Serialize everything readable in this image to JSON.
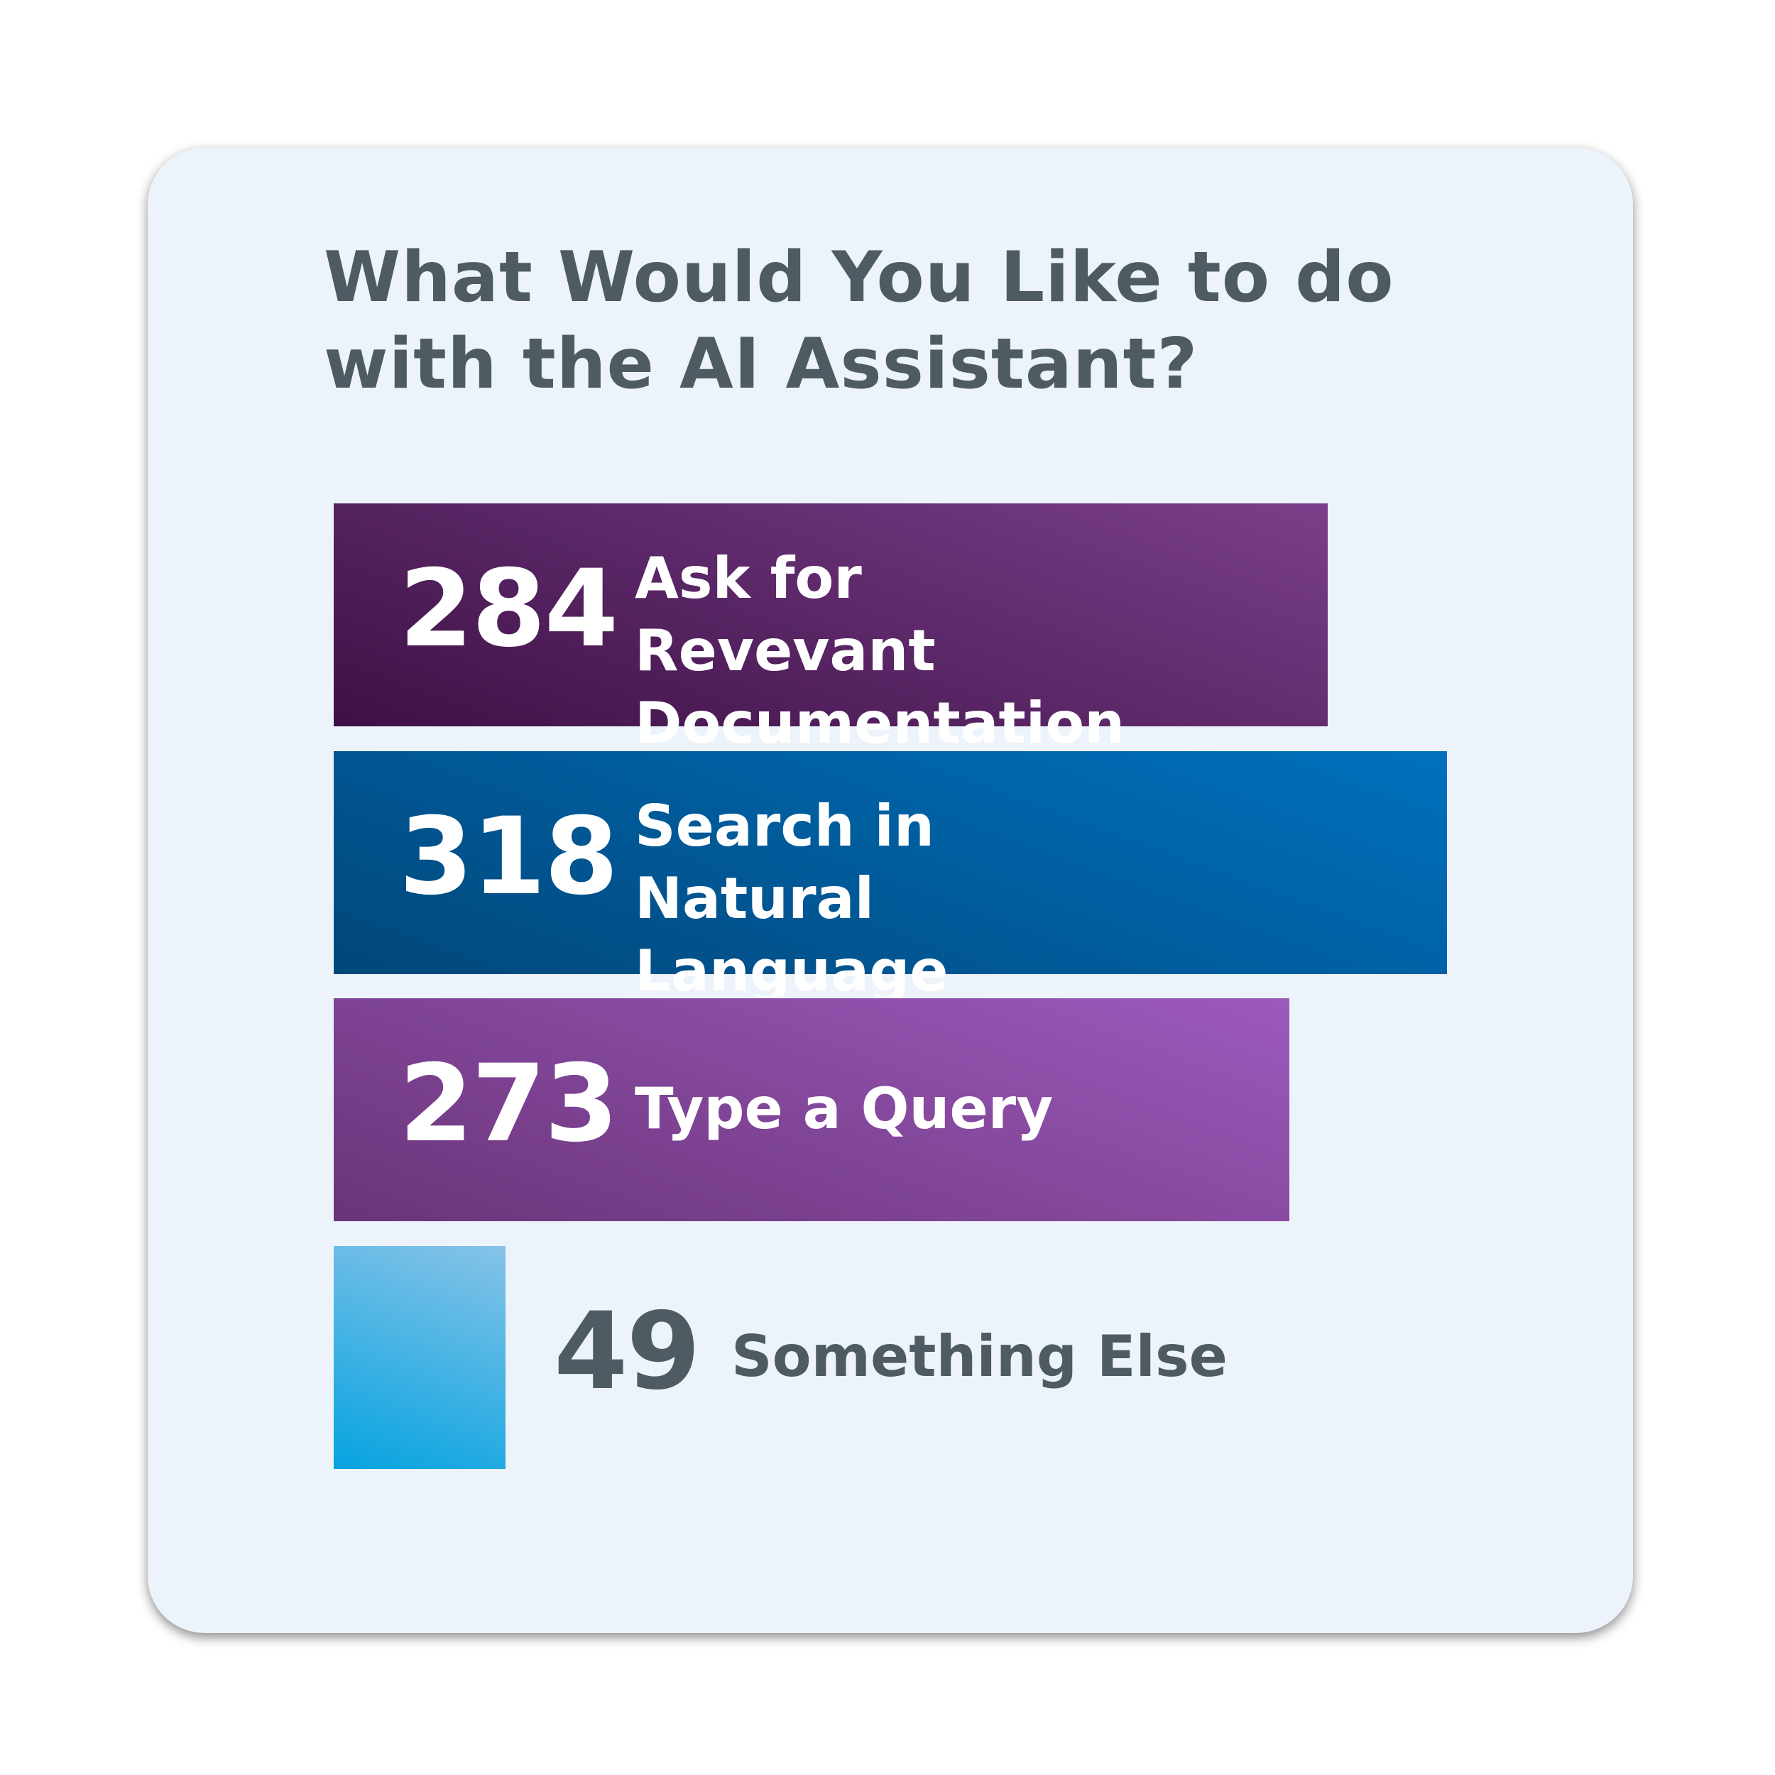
{
  "chart_data": {
    "type": "bar",
    "orientation": "horizontal",
    "title": "What Would You Like to do with the AI Assistant?",
    "categories": [
      "Ask for Revevant Documentation",
      "Search in Natural Language",
      "Type a Query",
      "Something Else"
    ],
    "values": [
      284,
      318,
      273,
      49
    ],
    "value_labels": [
      "284",
      "318",
      "273",
      "49"
    ],
    "colors": [
      [
        "#3d1045",
        "#7a3f8a"
      ],
      [
        "#01477a",
        "#0071be"
      ],
      [
        "#6a3478",
        "#9c5abd"
      ],
      [
        "#06a3e0",
        "#86c3e8"
      ]
    ],
    "xlabel": "",
    "ylabel": "",
    "xlim": [
      0,
      318
    ],
    "grid": false
  }
}
